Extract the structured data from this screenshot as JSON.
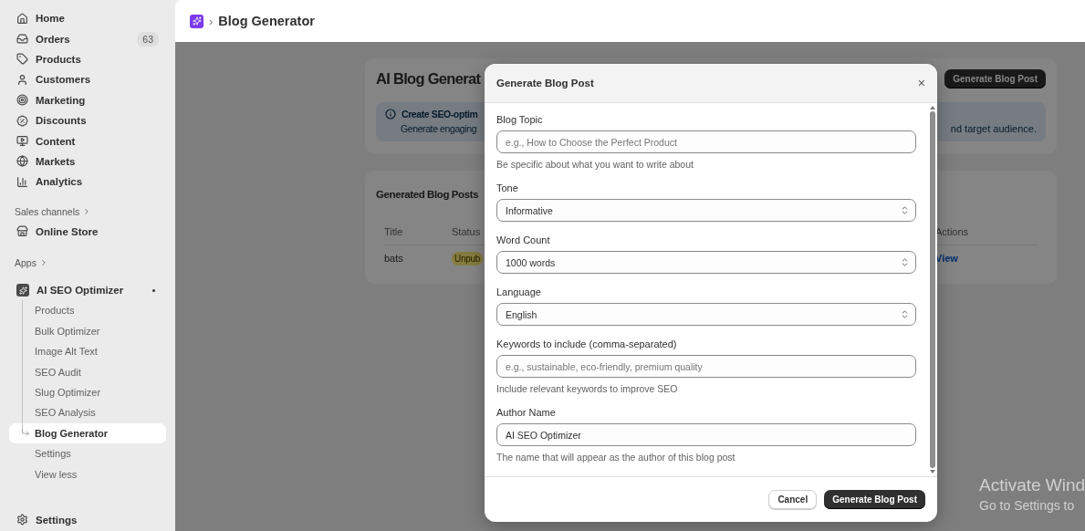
{
  "sidebar": {
    "main_items": [
      {
        "label": "Home",
        "selected": false
      },
      {
        "label": "Orders",
        "badge": "63",
        "selected": false
      },
      {
        "label": "Products",
        "selected": false
      },
      {
        "label": "Customers",
        "selected": false
      },
      {
        "label": "Marketing",
        "selected": false
      },
      {
        "label": "Discounts",
        "selected": false
      },
      {
        "label": "Content",
        "selected": false
      },
      {
        "label": "Markets",
        "selected": false
      },
      {
        "label": "Analytics",
        "selected": false
      }
    ],
    "sales_channels": {
      "heading": "Sales channels",
      "items": [
        {
          "label": "Online Store",
          "selected": false
        }
      ]
    },
    "apps": {
      "heading": "Apps",
      "app": {
        "label": "AI SEO Optimizer",
        "pinned": true,
        "children": [
          {
            "label": "Products",
            "selected": false
          },
          {
            "label": "Bulk Optimizer",
            "selected": false
          },
          {
            "label": "Image Alt Text",
            "selected": false
          },
          {
            "label": "SEO Audit",
            "selected": false
          },
          {
            "label": "Slug Optimizer",
            "selected": false
          },
          {
            "label": "SEO Analysis",
            "selected": false
          },
          {
            "label": "Blog Generator",
            "selected": true
          },
          {
            "label": "Settings",
            "selected": false
          },
          {
            "label": "View less",
            "selected": false
          }
        ]
      }
    },
    "settings": "Settings"
  },
  "top_bar": {
    "separator": "›",
    "title": "Blog Generator"
  },
  "page": {
    "title": "AI Blog Generat",
    "primary_button": "Generate Blog Post",
    "banner": {
      "title": "Create SEO-optim",
      "text_left": "Generate engaging",
      "text_right": "nd target audience."
    },
    "posts": {
      "title": "Generated Blog Posts",
      "columns": [
        "Title",
        "Status",
        "Actions"
      ],
      "rows": [
        {
          "title": "bats",
          "status": "Unpub",
          "action": "View"
        }
      ]
    }
  },
  "modal": {
    "title": "Generate Blog Post",
    "close": "×",
    "fields": [
      {
        "kind": "text",
        "label": "Blog Topic",
        "placeholder": "e.g., How to Choose the Perfect Product",
        "help": "Be specific about what you want to write about"
      },
      {
        "kind": "select",
        "label": "Tone",
        "value": "Informative"
      },
      {
        "kind": "select",
        "label": "Word Count",
        "value": "1000 words"
      },
      {
        "kind": "select",
        "label": "Language",
        "value": "English"
      },
      {
        "kind": "text",
        "label": "Keywords to include (comma-separated)",
        "placeholder": "e.g., sustainable, eco-friendly, premium quality",
        "help": "Include relevant keywords to improve SEO"
      },
      {
        "kind": "text",
        "label": "Author Name",
        "value": "AI SEO Optimizer",
        "help": "The name that will appear as the author of this blog post"
      }
    ],
    "buttons": [
      {
        "label": "Cancel",
        "kind": "secondary"
      },
      {
        "label": "Generate Blog Post",
        "kind": "primary"
      }
    ]
  },
  "os_notice": {
    "title": "Activate Wind",
    "text": "Go to Settings to"
  }
}
